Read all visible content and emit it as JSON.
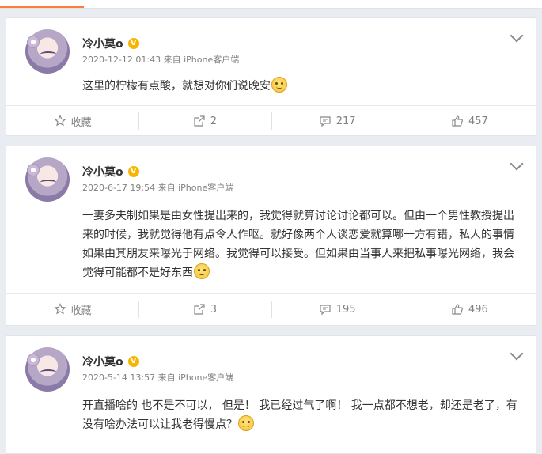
{
  "posts": [
    {
      "author": "冷小莫o",
      "verified_badge": "V",
      "meta": "2020-12-12 01:43 来自 iPhone客户端",
      "text": "这里的柠檬有点酸，就想对你们说晚安",
      "emoji": "smile-emoji",
      "actions": {
        "favorite": "收藏",
        "share": "2",
        "comment": "217",
        "like": "457"
      }
    },
    {
      "author": "冷小莫o",
      "verified_badge": "V",
      "meta": "2020-6-17 19:54 来自 iPhone客户端",
      "text": "一妻多夫制如果是由女性提出来的，我觉得就算讨论讨论都可以。但由一个男性教授提出来的时候，我就觉得他有点令人作呕。就好像两个人谈恋爱就算哪一方有错，私人的事情如果由其朋友来曝光于网络。我觉得可以接受。但如果由当事人来把私事曝光网络，我会觉得可能都不是好东西",
      "emoji": "smile-emoji",
      "actions": {
        "favorite": "收藏",
        "share": "3",
        "comment": "195",
        "like": "496"
      }
    },
    {
      "author": "冷小莫o",
      "verified_badge": "V",
      "meta": "2020-5-14 13:57 来自 iPhone客户端",
      "text": "开直播啥的 也不是不可以， 但是！ 我已经过气了啊！ 我一点都不想老，却还是老了，有没有啥办法可以让我老得慢点？",
      "emoji": "sad-emoji"
    }
  ],
  "colors": {
    "accent": "#fa7d3c",
    "verified": "#f7b500",
    "background": "#e9edf2"
  }
}
